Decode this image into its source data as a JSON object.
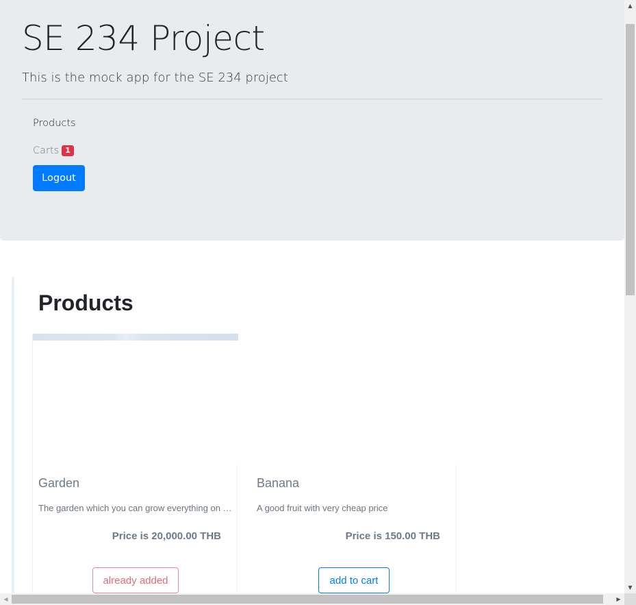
{
  "header": {
    "title": "SE 234 Project",
    "lead": "This is the mock app for the SE 234 project"
  },
  "nav": {
    "products_label": "Products",
    "carts_label": "Carts",
    "carts_count": "1",
    "logout_label": "Logout"
  },
  "products": {
    "heading": "Products",
    "items": [
      {
        "name": "Garden",
        "description": "The garden which you can grow everything on earth",
        "price": "Price is 20,000.00 THB",
        "button_label": "already added",
        "button_color": "#dc3545"
      },
      {
        "name": "Banana",
        "description": "A good fruit with very cheap price",
        "price": "Price is 150.00 THB",
        "button_label": "add to cart",
        "button_color": "#007bff"
      }
    ]
  },
  "colors": {
    "primary": "#007bff",
    "danger": "#dc3545",
    "jumbotron_bg": "#e9ecef"
  },
  "icons": {
    "scroll_up": "triangle-up-icon",
    "scroll_down": "triangle-down-icon",
    "scroll_left": "triangle-left-icon",
    "scroll_right": "triangle-right-icon"
  }
}
